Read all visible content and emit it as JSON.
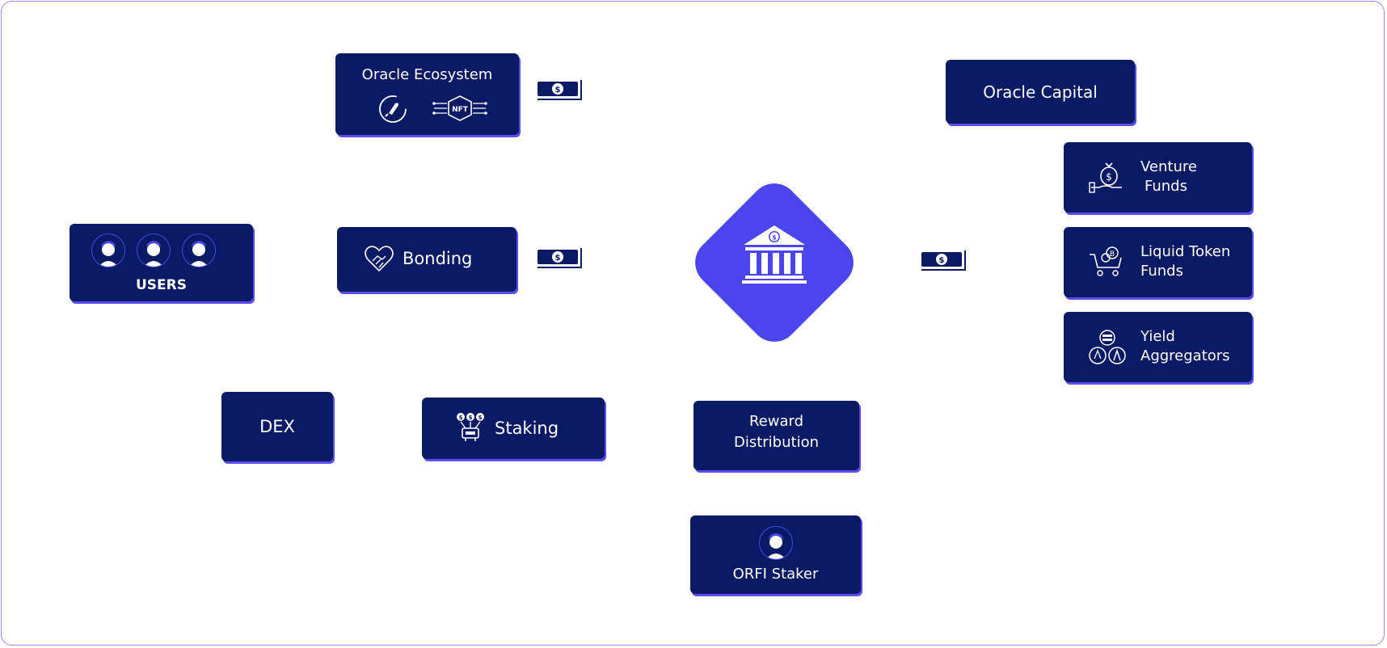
{
  "nodes": {
    "oracle_ecosystem": "Oracle Ecosystem",
    "oracle_capital": "Oracle Capital",
    "venture_funds": [
      "Venture",
      "Funds"
    ],
    "liquid_token_funds": [
      "Liquid Token",
      "Funds"
    ],
    "yield_aggregators": [
      "Yield",
      "Aggregators"
    ],
    "users": "USERS",
    "bonding": "Bonding",
    "dex": "DEX",
    "staking": "Staking",
    "reward_distribution": [
      "Reward",
      "Distribution"
    ],
    "orfi_staker": "ORFI Staker"
  },
  "colors": {
    "card": "#0b1a64",
    "accent": "#4b45f0",
    "frame": "#b07ee8"
  },
  "icons": [
    "rocket-icon",
    "nft-chip-icon",
    "money-bill-icon",
    "handshake-heart-icon",
    "bank-icon",
    "money-bag-hand-icon",
    "crypto-cart-icon",
    "crypto-coins-icon",
    "money-tree-icon",
    "user-avatar-icon"
  ]
}
